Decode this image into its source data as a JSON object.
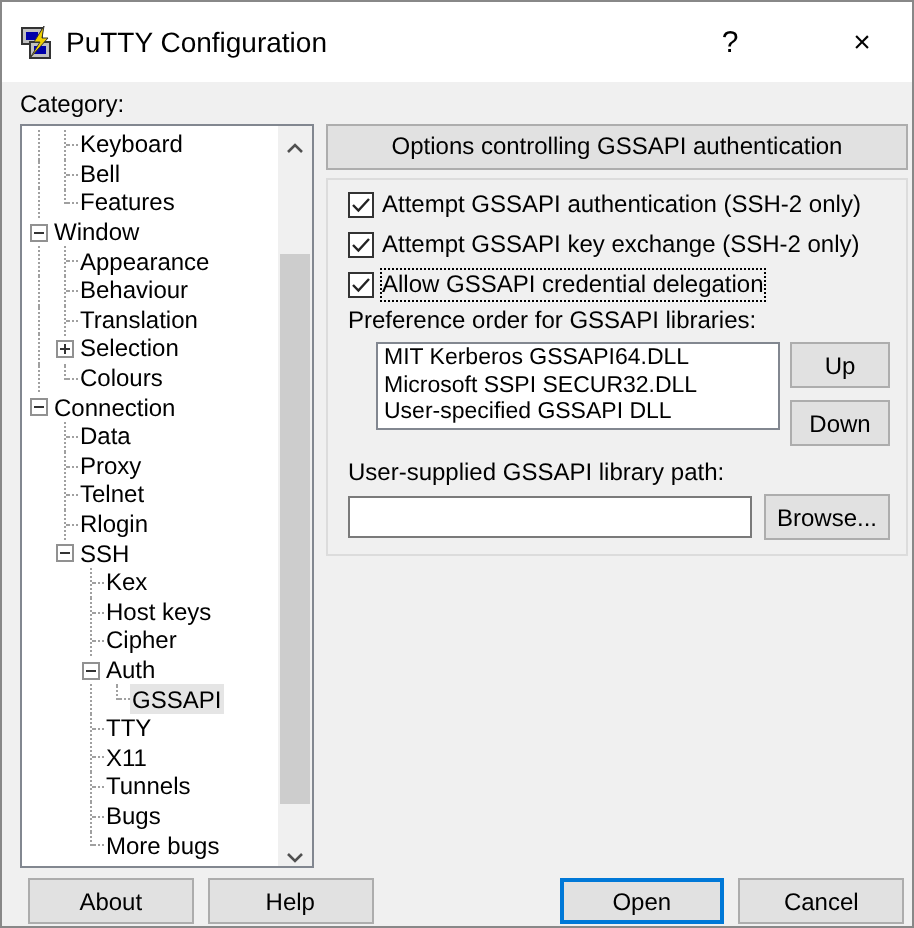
{
  "window": {
    "title": "PuTTY Configuration",
    "help": "?",
    "close": "×"
  },
  "category_label": "Category:",
  "tree": [
    {
      "children": [
        {
          "label": "Keyboard",
          "selected": false
        },
        {
          "label": "Bell",
          "selected": false
        },
        {
          "label": "Features",
          "selected": false
        }
      ]
    },
    {
      "label": "Window",
      "expanded": true,
      "selected": false,
      "children": [
        {
          "label": "Appearance",
          "selected": false
        },
        {
          "label": "Behaviour",
          "selected": false
        },
        {
          "label": "Translation",
          "selected": false
        },
        {
          "label": "Selection",
          "expanded": false,
          "selected": false
        },
        {
          "label": "Colours",
          "selected": false
        }
      ]
    },
    {
      "label": "Connection",
      "expanded": true,
      "selected": false,
      "children": [
        {
          "label": "Data",
          "selected": false
        },
        {
          "label": "Proxy",
          "selected": false
        },
        {
          "label": "Telnet",
          "selected": false
        },
        {
          "label": "Rlogin",
          "selected": false
        },
        {
          "label": "SSH",
          "expanded": true,
          "selected": false,
          "children": [
            {
              "label": "Kex",
              "selected": false
            },
            {
              "label": "Host keys",
              "selected": false
            },
            {
              "label": "Cipher",
              "selected": false
            },
            {
              "label": "Auth",
              "expanded": true,
              "selected": false,
              "children": [
                {
                  "label": "GSSAPI",
                  "selected": true
                }
              ]
            },
            {
              "label": "TTY",
              "selected": false
            },
            {
              "label": "X11",
              "selected": false
            },
            {
              "label": "Tunnels",
              "selected": false
            },
            {
              "label": "Bugs",
              "selected": false
            },
            {
              "label": "More bugs",
              "selected": false
            }
          ]
        }
      ]
    }
  ],
  "panel_title": "Options controlling GSSAPI authentication",
  "options": [
    {
      "label": "Attempt GSSAPI authentication (SSH-2 only)",
      "checked": true,
      "focused": false
    },
    {
      "label": "Attempt GSSAPI key exchange (SSH-2 only)",
      "checked": true,
      "focused": false
    },
    {
      "label": "Allow GSSAPI credential delegation",
      "checked": true,
      "focused": true
    }
  ],
  "libraries_label": "Preference order for GSSAPI libraries:",
  "libraries": [
    "MIT Kerberos GSSAPI64.DLL",
    "Microsoft SSPI SECUR32.DLL",
    "User-specified GSSAPI DLL"
  ],
  "order_buttons": [
    "Up",
    "Down"
  ],
  "path_label": "User-supplied GSSAPI library path:",
  "browse_button": "Browse...",
  "footer_buttons": [
    {
      "label": "About",
      "default": false
    },
    {
      "label": "Help",
      "default": false
    },
    {
      "label": "Open",
      "default": true
    },
    {
      "label": "Cancel",
      "default": false
    }
  ]
}
